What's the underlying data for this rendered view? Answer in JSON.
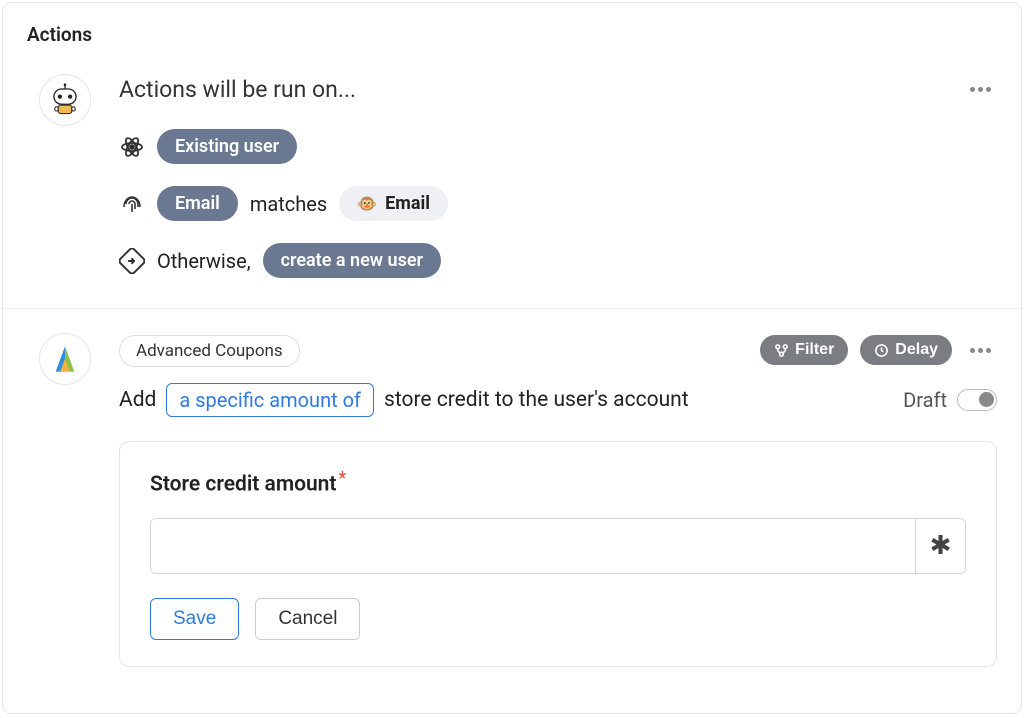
{
  "section_title": "Actions",
  "trigger_block": {
    "heading": "Actions will be run on...",
    "row1": {
      "pill": "Existing user"
    },
    "row2": {
      "left_pill": "Email",
      "matches": "matches",
      "right_pill": "Email"
    },
    "row3": {
      "otherwise": "Otherwise,",
      "pill": "create a new user"
    }
  },
  "action_block": {
    "tag": "Advanced Coupons",
    "filter_label": "Filter",
    "delay_label": "Delay",
    "sentence_pre": "Add",
    "param_chip": "a specific amount of",
    "sentence_post": "store credit to the user's account",
    "draft_label": "Draft",
    "form": {
      "label": "Store credit amount",
      "input_value": "",
      "save": "Save",
      "cancel": "Cancel"
    }
  }
}
